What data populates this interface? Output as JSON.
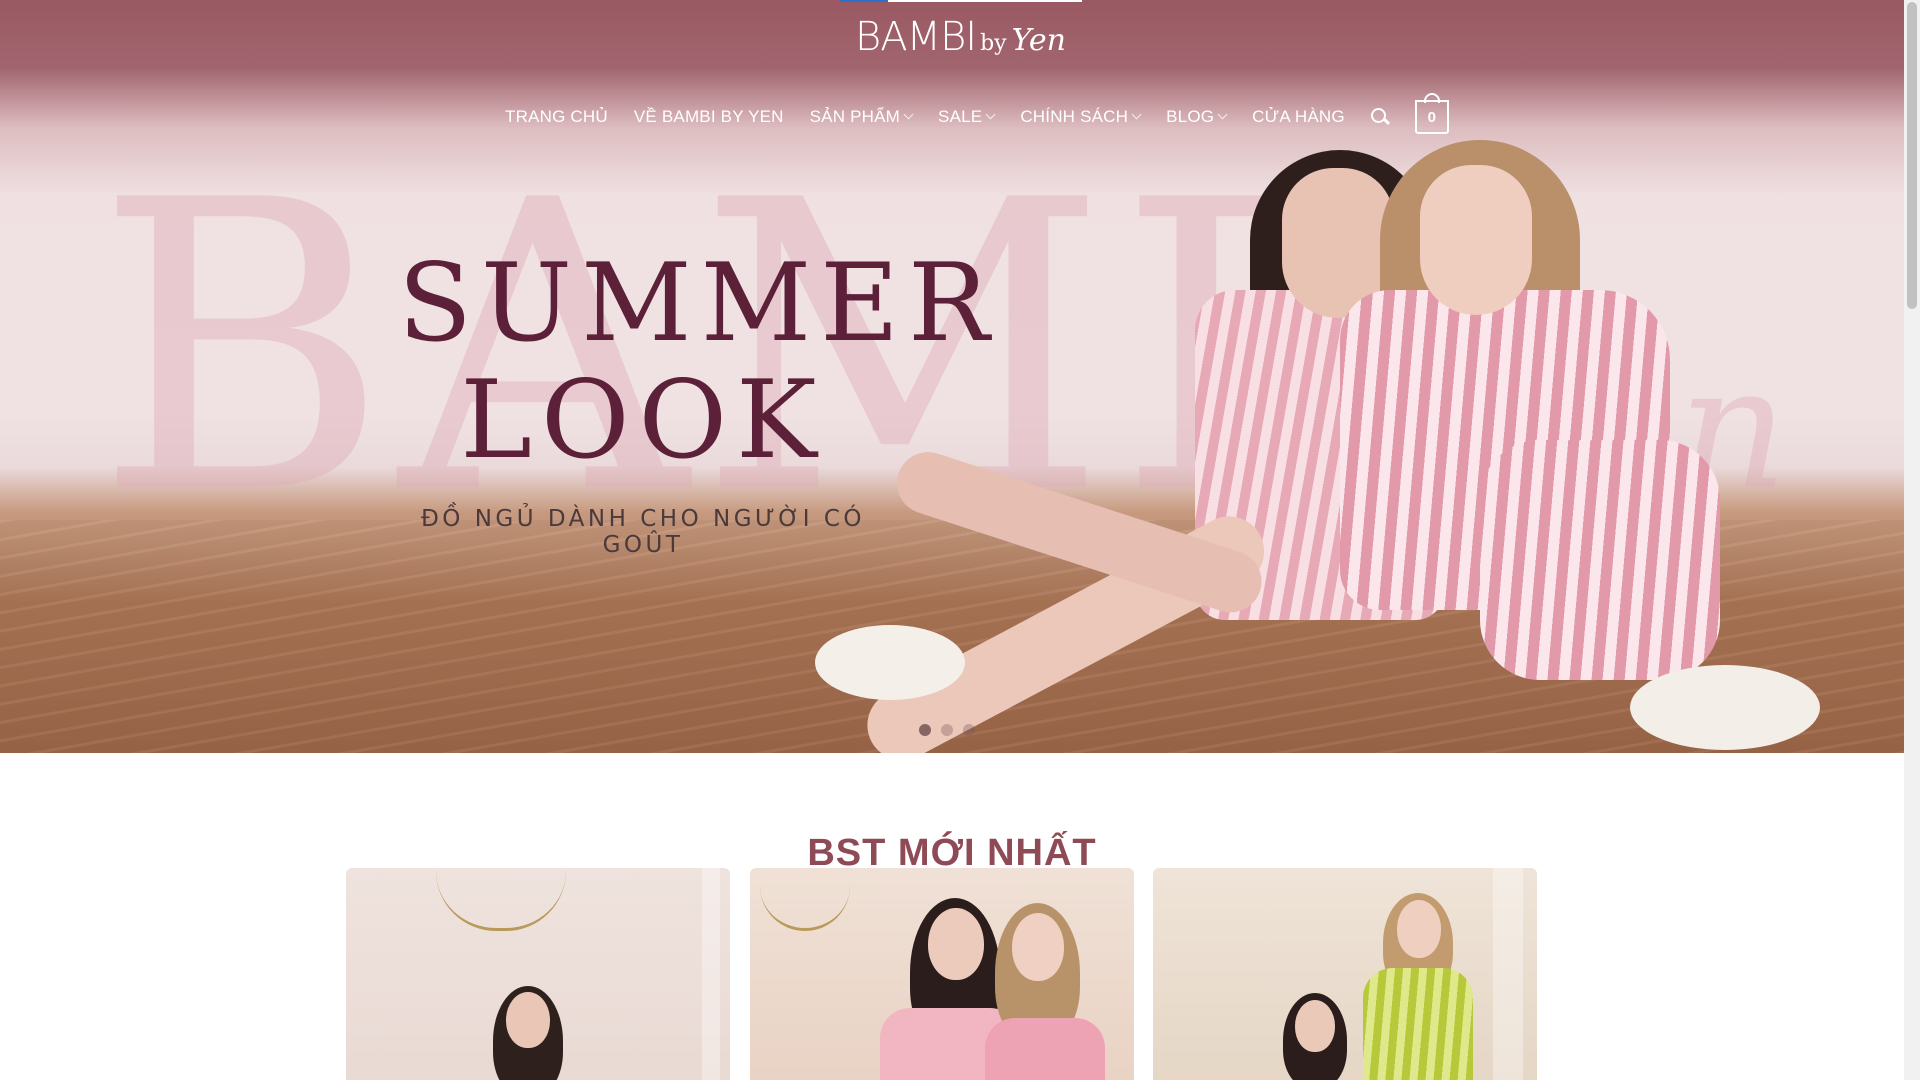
{
  "header": {
    "logo": {
      "main": "BAMBI",
      "by": "by",
      "script": "Yen"
    },
    "nav": [
      {
        "label": "TRANG CHỦ",
        "has_dropdown": false
      },
      {
        "label": "VỀ BAMBI BY YEN",
        "has_dropdown": false
      },
      {
        "label": "SẢN PHẨM",
        "has_dropdown": true
      },
      {
        "label": "SALE",
        "has_dropdown": true
      },
      {
        "label": "CHÍNH SÁCH",
        "has_dropdown": true
      },
      {
        "label": "BLOG",
        "has_dropdown": true
      },
      {
        "label": "CỬA HÀNG",
        "has_dropdown": false
      }
    ],
    "search_icon": "search-icon",
    "cart_count": "0"
  },
  "hero": {
    "watermark": "BAMBI",
    "watermark_script": "Yen",
    "headline_line1": "SUMMER",
    "headline_line2": "LOOK",
    "tagline": "ĐỒ NGỦ DÀNH CHO NGƯỜI CÓ GOÛT",
    "slides_count": 3,
    "active_slide": 1
  },
  "collection": {
    "title": "BST MỚI NHẤT",
    "cards": [
      "card-1",
      "card-2",
      "card-3"
    ]
  },
  "colors": {
    "header_bg": "#9a5963",
    "title_color": "#8e4a55",
    "headline_color": "#5c2038"
  }
}
